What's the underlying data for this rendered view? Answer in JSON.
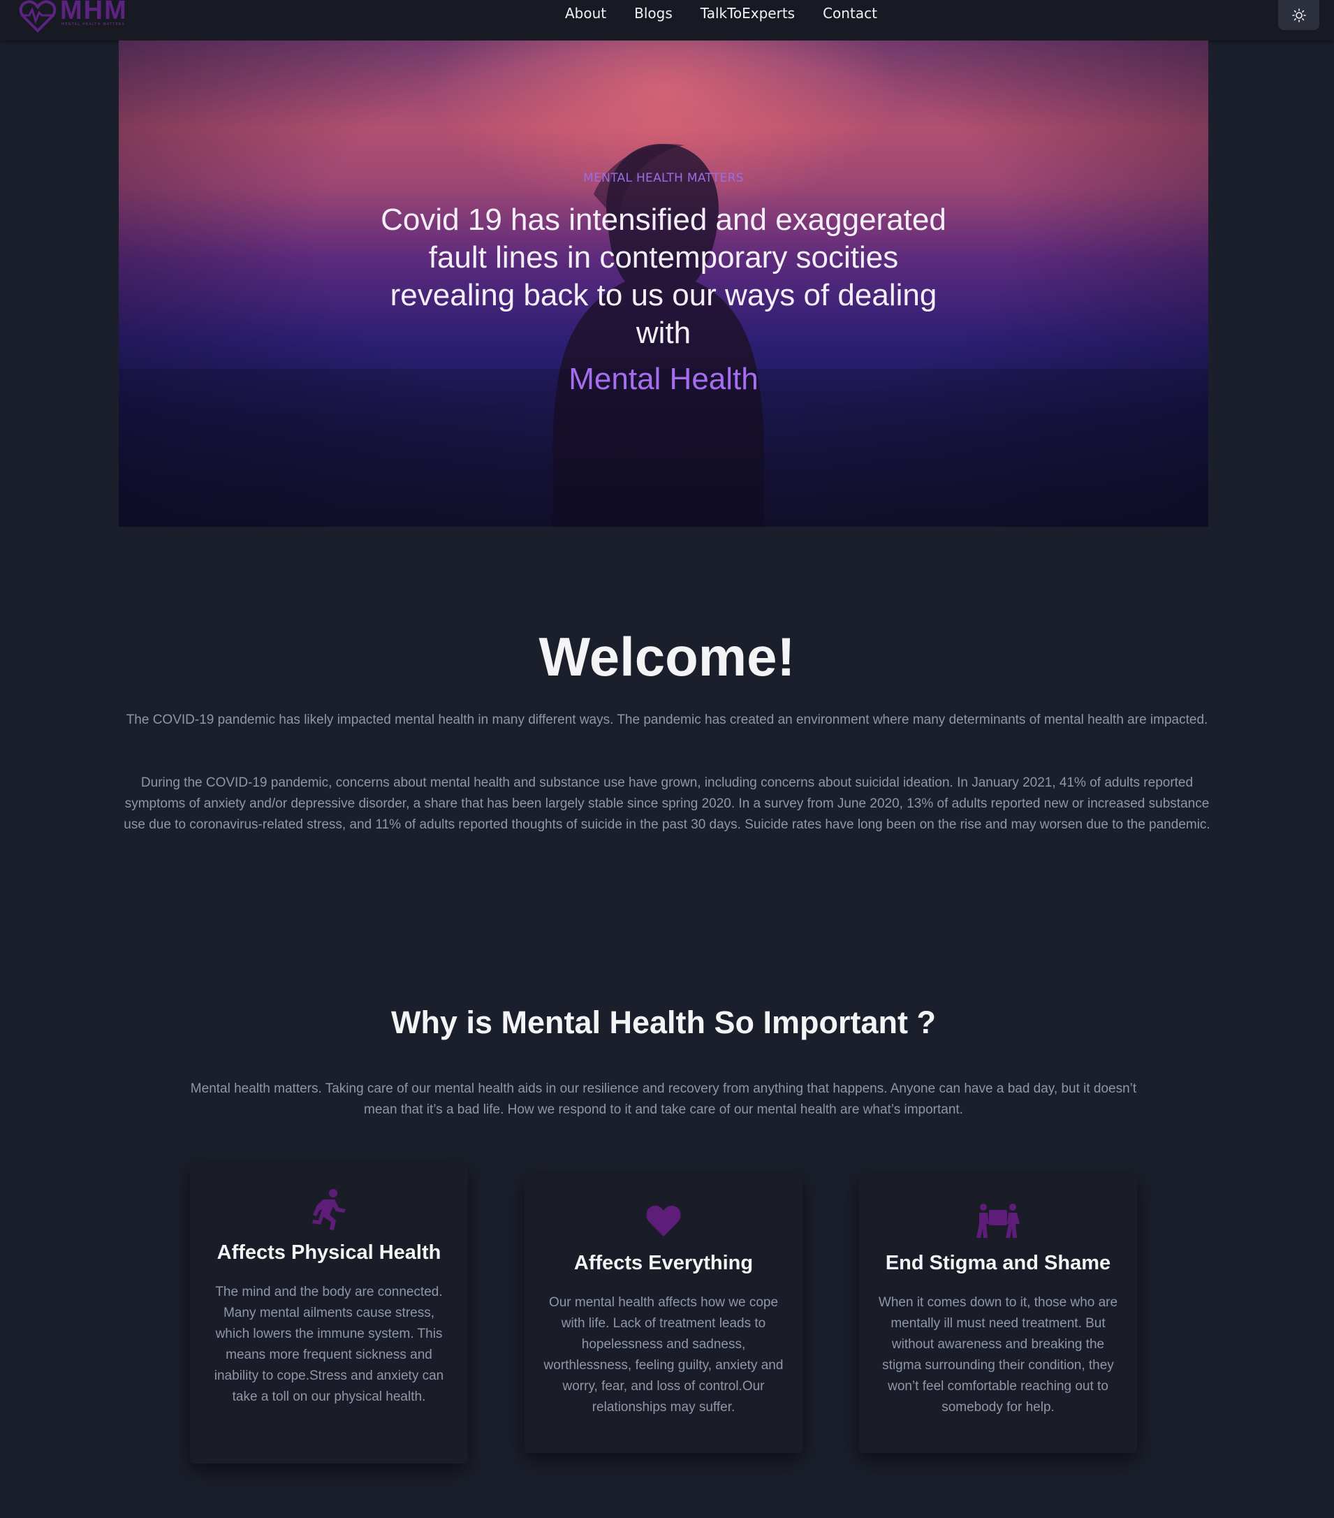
{
  "nav": {
    "logo_text": "MHM",
    "logo_tagline": "MENTAL HEALTH MATTERS",
    "links": [
      "About",
      "Blogs",
      "TalkToExperts",
      "Contact"
    ],
    "theme_toggle_icon": "sun-icon"
  },
  "hero": {
    "kicker": "MENTAL HEALTH MATTERS",
    "title": "Covid 19 has intensified and exaggerated fault lines in contemporary socities revealing back to us our ways of dealing with",
    "accent": "Mental Health"
  },
  "welcome": {
    "title": "Welcome!",
    "paragraph1": "The COVID-19 pandemic has likely impacted mental health in many different ways. The pandemic has created an environment where many determinants of mental health are impacted.",
    "paragraph2": "During the COVID-19 pandemic, concerns about mental health and substance use have grown, including concerns about suicidal ideation. In January 2021, 41% of adults reported symptoms of anxiety and/or depressive disorder, a share that has been largely stable since spring 2020. In a survey from June 2020, 13% of adults reported new or increased substance use due to coronavirus-related stress, and 11% of adults reported thoughts of suicide in the past 30 days. Suicide rates have long been on the rise and may worsen due to the pandemic."
  },
  "why": {
    "title": "Why is Mental Health So Important ?",
    "description": "Mental health matters. Taking care of our mental health aids in our resilience and recovery from anything that happens. Anyone can have a bad day, but it doesn’t mean that it’s a bad life. How we respond to it and take care of our mental health are what’s important.",
    "cards": [
      {
        "icon": "running-person-icon",
        "title": "Affects Physical Health",
        "text": "The mind and the body are connected. Many mental ailments cause stress, which lowers the immune system. This means more frequent sickness and inability to cope.Stress and anxiety can take a toll on our physical health."
      },
      {
        "icon": "heart-icon",
        "title": "Affects Everything",
        "text": "Our mental health affects how we cope with life. Lack of treatment leads to hopelessness and sadness, worthlessness, feeling guilty, anxiety and worry, fear, and loss of control.Our relationships may suffer."
      },
      {
        "icon": "people-carrying-box-icon",
        "title": "End Stigma and Shame",
        "text": "When it comes down to it, those who are mentally ill must need treatment. But without awareness and breaking the stigma surrounding their condition, they won’t feel comfortable reaching out to somebody for help."
      }
    ]
  },
  "colors": {
    "background": "#1b1f2b",
    "accent_purple": "#a56ef0",
    "icon_purple": "#5e1d78",
    "muted_text": "#8e96a8"
  }
}
